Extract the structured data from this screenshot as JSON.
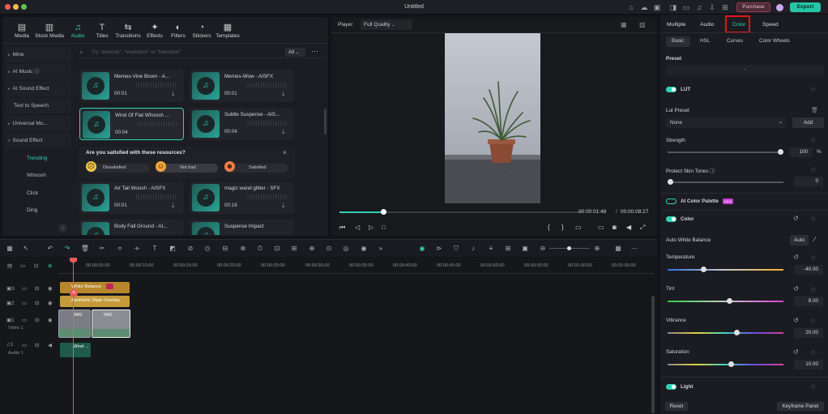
{
  "window": {
    "title": "Untitled"
  },
  "header": {
    "purchase_label": "Purchase",
    "export_label": "Export"
  },
  "media_tabs": [
    {
      "label": "Media",
      "icon": "media-icon"
    },
    {
      "label": "Stock Media",
      "icon": "stock-media-icon"
    },
    {
      "label": "Audio",
      "icon": "audio-icon"
    },
    {
      "label": "Titles",
      "icon": "titles-icon"
    },
    {
      "label": "Transitions",
      "icon": "transitions-icon"
    },
    {
      "label": "Effects",
      "icon": "effects-icon"
    },
    {
      "label": "Filters",
      "icon": "filters-icon"
    },
    {
      "label": "Stickers",
      "icon": "stickers-icon"
    },
    {
      "label": "Templates",
      "icon": "templates-icon"
    }
  ],
  "sidebar": {
    "items": [
      "Mine",
      "AI Music",
      "AI Sound Effect",
      "Text to Speech",
      "Universal Mu...",
      "Sound Effect"
    ],
    "sub_items": [
      "Trending",
      "Whoosh",
      "Click",
      "Ding"
    ]
  },
  "search": {
    "placeholder": "Try \"whoosh\", \"explosion\" or \"transition\"",
    "filter": "All"
  },
  "audio_cards": [
    {
      "name": "Memes-Vine Boom - A...",
      "duration": "00:01"
    },
    {
      "name": "Memes-Wow - AISFX",
      "duration": "00:01"
    },
    {
      "name": "Wind Of Flat Whoosh ...",
      "duration": "00:04"
    },
    {
      "name": "Subtle Suspense - AIS...",
      "duration": "00:04"
    },
    {
      "name": "Air Tail Woosh - AISFX",
      "duration": "00:01"
    },
    {
      "name": "magic wand glitter - SFX",
      "duration": "00:16"
    },
    {
      "name": "Body Fall Ground - AI...",
      "duration": ""
    },
    {
      "name": "Suspense Impact",
      "duration": ""
    }
  ],
  "survey": {
    "question": "Are you satisfied with these resources?",
    "options": [
      "Dissatisfied",
      "Not bad",
      "Satisfied"
    ]
  },
  "player": {
    "label": "Player",
    "quality": "Full Quality",
    "current_time": "00:00:01:48",
    "separator": "/",
    "total_time": "00:00:08:27",
    "progress": 0.18
  },
  "right_panel": {
    "tabs": [
      "Multiple",
      "Audio",
      "Color",
      "Speed"
    ],
    "active_tab": "Color",
    "sub_tabs": [
      "Basic",
      "HSL",
      "Curves",
      "Color Wheels"
    ],
    "preset_label": "Preset",
    "lut_label": "LUT",
    "lut_preset_label": "Lut Preset",
    "lut_preset_value": "None",
    "add_label": "Add",
    "strength_label": "Strength",
    "strength_value": "100",
    "strength_unit": "%",
    "strength_level": 1.0,
    "protect_label": "Protect Skin Tones",
    "protect_value": "0",
    "protect_level": 0.0,
    "ai_palette_label": "AI Color Palette",
    "ai_badge": "NEW",
    "color_label": "Color",
    "auto_wb_label": "Auto White Balance",
    "auto_label": "Auto",
    "temperature_label": "Temperature",
    "temperature_value": "-40.00",
    "temperature_level": 0.3,
    "tint_label": "Tint",
    "tint_value": "8.00",
    "tint_level": 0.54,
    "vibrance_label": "Vibrance",
    "vibrance_value": "20.00",
    "vibrance_level": 0.6,
    "saturation_label": "Saturation",
    "saturation_value": "10.00",
    "saturation_level": 0.55,
    "light_label": "Light",
    "reset_label": "Reset",
    "keyframe_label": "Keyframe Panel"
  },
  "timeline": {
    "ruler": [
      "00:00:05:00",
      "00:00:10:00",
      "00:00:15:00",
      "00:00:20:00",
      "00:00:25:00",
      "00:00:30:00",
      "00:00:35:00",
      "00:00:40:00",
      "00:00:45:00",
      "00:00:50:00",
      "00:00:55:00",
      "00:01:00:00",
      "00:01:05:00"
    ],
    "tracks": [
      {
        "num": "3",
        "label": ""
      },
      {
        "num": "2",
        "label": ""
      },
      {
        "num": "1",
        "label": "Video 1"
      },
      {
        "num": "1",
        "label": "Audio 1"
      }
    ],
    "clips": {
      "white_balance": "White Balance",
      "overlay": "Aesthetic Style Overlay",
      "video1": "IMG",
      "video2": "IMG",
      "audio": "Wind ..."
    }
  },
  "colors": {
    "accent": "#2fd3b5",
    "highlight_box": "#e0141b",
    "export": "#27c4a7",
    "purchase": "#9b3c56"
  }
}
